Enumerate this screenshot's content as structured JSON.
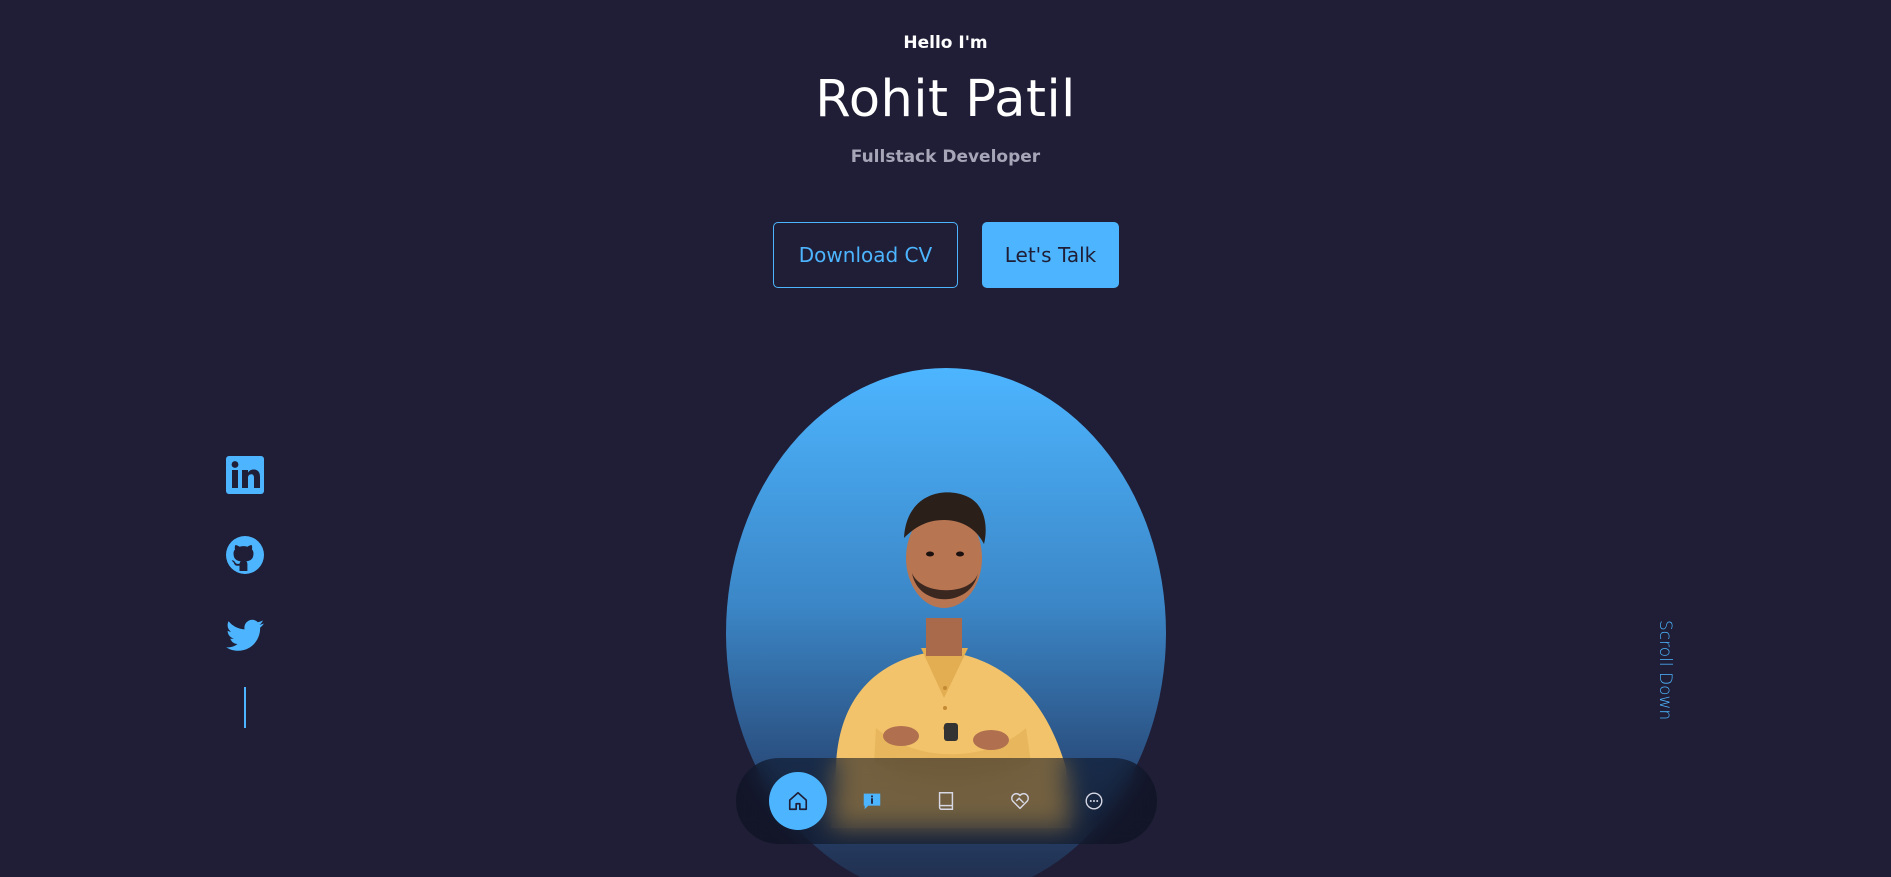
{
  "hero": {
    "greeting": "Hello I'm",
    "name": "Rohit Patil",
    "role": "Fullstack Developer"
  },
  "buttons": {
    "download_cv": "Download CV",
    "lets_talk": "Let's Talk"
  },
  "socials": [
    {
      "icon": "linkedin-icon"
    },
    {
      "icon": "github-icon"
    },
    {
      "icon": "twitter-icon"
    }
  ],
  "scroll": {
    "label": "Scroll Down"
  },
  "nav": {
    "items": [
      {
        "icon": "home-icon",
        "active": true
      },
      {
        "icon": "info-chat-icon",
        "active": false
      },
      {
        "icon": "book-icon",
        "active": false
      },
      {
        "icon": "heart-handshake-icon",
        "active": false
      },
      {
        "icon": "chat-bubble-icon",
        "active": false
      }
    ]
  },
  "colors": {
    "background": "#1f1e36",
    "accent": "#4db5ff",
    "muted_text": "#a6a6b8"
  }
}
